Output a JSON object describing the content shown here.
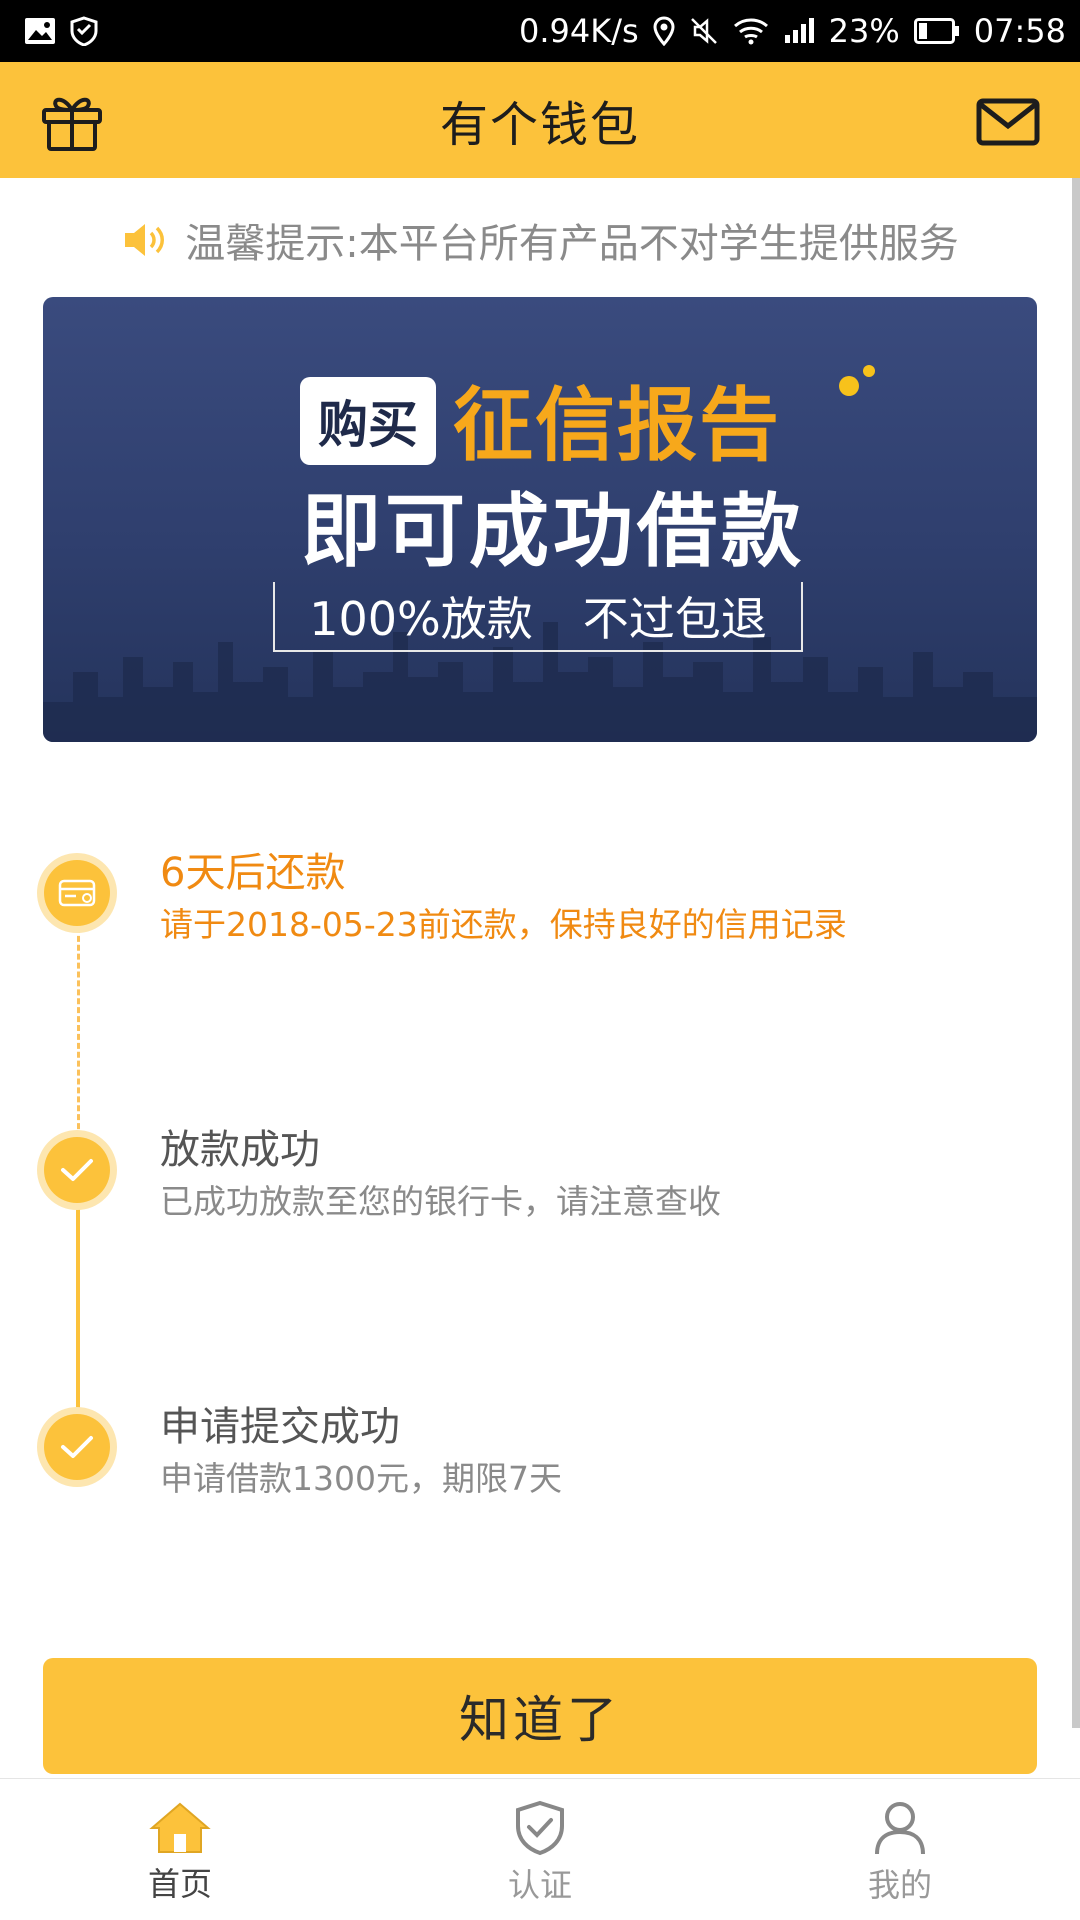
{
  "status_bar": {
    "speed": "0.94K/s",
    "battery": "23%",
    "time": "07:58"
  },
  "header": {
    "title": "有个钱包"
  },
  "notice": {
    "text": "温馨提示:本平台所有产品不对学生提供服务"
  },
  "banner": {
    "tag": "购买",
    "headline_orange": "征信报告",
    "headline_white": "即可成功借款",
    "promise_left": "100%放款",
    "promise_right": "不过包退"
  },
  "steps": [
    {
      "title": "6天后还款",
      "desc": "请于2018-05-23前还款，保持良好的信用记录",
      "icon": "card-icon"
    },
    {
      "title": "放款成功",
      "desc": "已成功放款至您的银行卡，请注意查收",
      "icon": "check-icon"
    },
    {
      "title": "申请提交成功",
      "desc": "申请借款1300元，期限7天",
      "icon": "check-icon"
    }
  ],
  "confirm": {
    "label": "知道了"
  },
  "nav": {
    "items": [
      {
        "label": "首页",
        "icon": "home-icon"
      },
      {
        "label": "认证",
        "icon": "shield-check-icon"
      },
      {
        "label": "我的",
        "icon": "user-icon"
      }
    ]
  },
  "colors": {
    "accent": "#fcc23b",
    "orange_text": "#f08a12",
    "banner_bg": "#2f3f6e"
  }
}
